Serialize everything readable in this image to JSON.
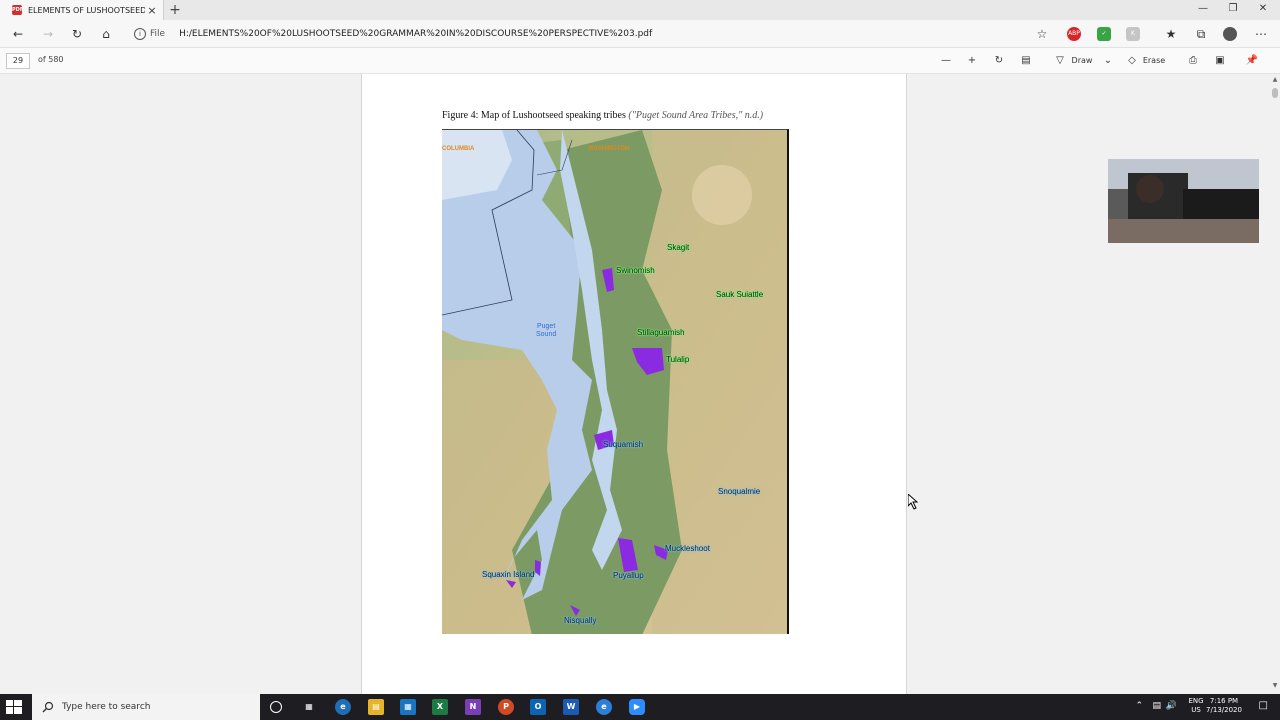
{
  "browser": {
    "tab_title": "ELEMENTS OF LUSHOOTSEED G",
    "tab_close": "×",
    "new_tab": "+",
    "address_prefix": "File",
    "url": "H:/ELEMENTS%20OF%20LUSHOOTSEED%20GRAMMAR%20IN%20DISCOURSE%20PERSPECTIVE%203.pdf"
  },
  "pdf_toolbar": {
    "page_number": "29",
    "page_total": "of 580",
    "draw_label": "Draw",
    "erase_label": "Erase"
  },
  "document": {
    "caption": "Figure 4: Map of Lushootseed speaking tribes",
    "citation": "(\"Puget Sound Area Tribes,\" n.d.)",
    "map": {
      "regions": [
        "COLUMBIA",
        "WASHINGTON"
      ],
      "water_label_line1": "Puget",
      "water_label_line2": "Sound",
      "tribes": [
        "Skagit",
        "Swinomish",
        "Sauk Suiattle",
        "Stillaguamish",
        "Tulalip",
        "Suquamish",
        "Snoqualmie",
        "Muckleshoot",
        "Squaxin Island",
        "Puyallup",
        "Nisqually"
      ]
    }
  },
  "taskbar": {
    "search_placeholder": "Type here to search",
    "lang": "ENG",
    "region": "US",
    "time": "7:16 PM",
    "date": "7/13/2020"
  },
  "colors": {
    "reservation": "#8a2be2",
    "tribe_glow": "#7fff7f",
    "pdf_red": "#d32f2f",
    "taskbar": "#1d1d22"
  }
}
